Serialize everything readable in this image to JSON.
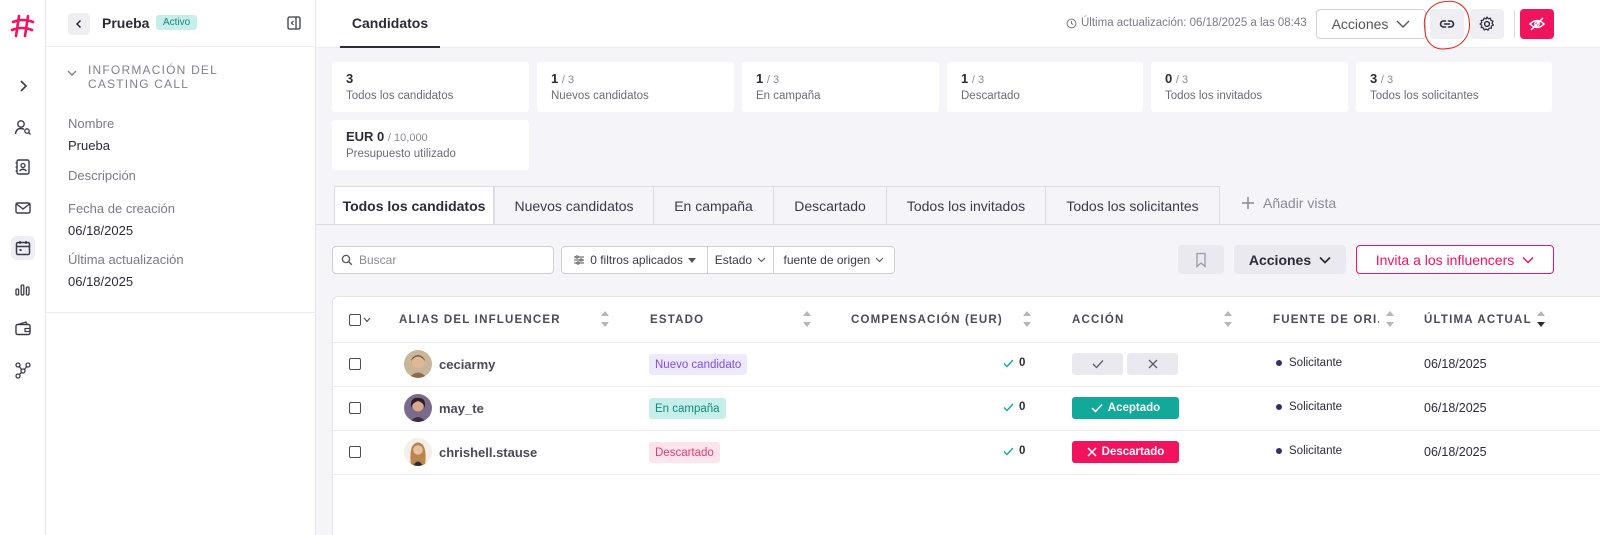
{
  "colors": {
    "accent": "#f0145f",
    "teal": "#12a89a",
    "purple_badge_bg": "#efe9ff",
    "purple_badge_fg": "#7b4fe0"
  },
  "rail": {
    "items": [
      "chevron-right-icon",
      "user-search-icon",
      "contacts-icon",
      "mail-icon",
      "calendar-icon",
      "bar-chart-icon",
      "wallet-icon",
      "network-icon"
    ]
  },
  "panel": {
    "title": "Prueba",
    "badge": "Activo",
    "section_title_1": "INFORMACIÓN DEL",
    "section_title_2": "CASTING CALL",
    "fields": [
      {
        "label": "Nombre",
        "value": "Prueba"
      },
      {
        "label": "Descripción",
        "value": ""
      },
      {
        "label": "Fecha de creación",
        "value": "06/18/2025"
      },
      {
        "label": "Última actualización",
        "value": "06/18/2025"
      }
    ]
  },
  "topbar": {
    "tab": "Candidatos",
    "last_update": "Última actualización: 06/18/2025 a las 08:43",
    "actions_label": "Acciones"
  },
  "stats": [
    {
      "num": "3",
      "den": "",
      "label": "Todos los candidatos"
    },
    {
      "num": "1",
      "den": "/ 3",
      "label": "Nuevos candidatos"
    },
    {
      "num": "1",
      "den": "/ 3",
      "label": "En campaña"
    },
    {
      "num": "1",
      "den": "/ 3",
      "label": "Descartado"
    },
    {
      "num": "0",
      "den": "/ 3",
      "label": "Todos los invitados"
    },
    {
      "num": "3",
      "den": "/ 3",
      "label": "Todos los solicitantes"
    },
    {
      "num": "EUR 0",
      "den": "/ 10,000",
      "label": "Presupuesto utilizado"
    }
  ],
  "view_tabs": [
    "Todos los candidatos",
    "Nuevos candidatos",
    "En campaña",
    "Descartado",
    "Todos los invitados",
    "Todos los solicitantes"
  ],
  "add_view": "Añadir vista",
  "toolbar": {
    "search_placeholder": "Buscar",
    "filters_applied": "0 filtros aplicados",
    "filter_estado": "Estado",
    "filter_fuente": "fuente de origen",
    "actions_label": "Acciones",
    "invite_label": "Invita a los influencers"
  },
  "table": {
    "headers": [
      "ALIAS DEL INFLUENCER",
      "ESTADO",
      "COMPENSACIÓN (EUR)",
      "ACCIÓN",
      "FUENTE DE ORI...",
      "ÚLTIMA ACTUAL..."
    ],
    "rows": [
      {
        "alias": "ceciarmy",
        "state": "Nuevo candidato",
        "comp": "0",
        "action": "",
        "source": "Solicitante",
        "date": "06/18/2025"
      },
      {
        "alias": "may_te",
        "state": "En campaña",
        "comp": "0",
        "action": "Aceptado",
        "source": "Solicitante",
        "date": "06/18/2025"
      },
      {
        "alias": "chrishell.stause",
        "state": "Descartado",
        "comp": "0",
        "action": "Descartado",
        "source": "Solicitante",
        "date": "06/18/2025"
      }
    ]
  }
}
